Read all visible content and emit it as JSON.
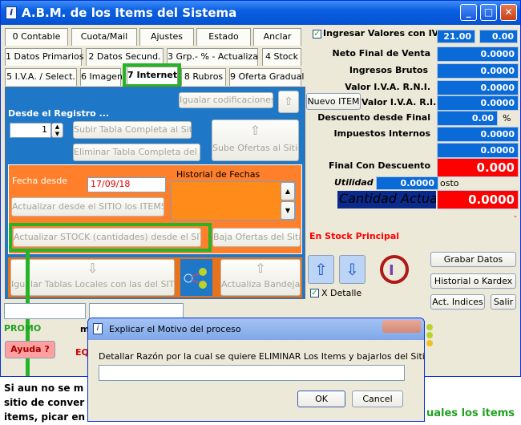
{
  "window": {
    "title": "A.B.M. de los Items del Sistema",
    "min": "_",
    "max": "□",
    "close": "✕",
    "icon": "app-icon"
  },
  "tabs_row1": [
    "0 Contable",
    "Cuota/Mail",
    "Ajustes",
    "Estado",
    "Anclar"
  ],
  "tabs_row2": [
    "1 Datos Primarios",
    "2 Datos Secund.",
    "3 Grp.- % - Actualiza",
    "4 Stock"
  ],
  "tabs_row3": [
    "5 I.V.A. / Select.",
    "6 Imagen",
    "7 Internet",
    "8 Rubros",
    "9 Oferta Gradual"
  ],
  "internet": {
    "igualar_cod": "Igualar codificaciones",
    "desde_registro": "Desde el Registro ...",
    "registro_value": "1",
    "subir_tabla": "Subir Tabla Completa al Sitio",
    "eliminar_tabla": "Eliminar Tabla Completa del Sitio",
    "sube_ofertas": "Sube Ofertas al Sitio",
    "fecha_desde_label": "Fecha desde",
    "fecha_desde_value": "17/09/18",
    "historial_label": "Historial de Fechas",
    "actualizar_items": "Actualizar  desde el SITIO los ITEMS",
    "actualizar_stock": "Actualizar  STOCK (cantidades) desde el SITIO",
    "baja_ofertas": "Baja Ofertas del Sitio",
    "igualar_tablas": "Igualar Tablas Locales con las del SITIO",
    "actualiza_bandeja": "Actualiza Bandeja"
  },
  "right": {
    "ingresar_label": "Ingresar Valores con IVA",
    "iva_rate": "21.00",
    "iva_val": "0.00",
    "rows": [
      {
        "label": "Neto Final de Venta",
        "value": "0.0000"
      },
      {
        "label": "Ingresos Brutos",
        "value": "0.0000"
      },
      {
        "label": "Valor I.V.A. R.N.I.",
        "value": "0.0000"
      },
      {
        "label": "Valor I.V.A. R.I.",
        "value": "0.0000"
      },
      {
        "label": "Descuento desde Final",
        "value": "0.00"
      },
      {
        "label": "Impuestos Internos",
        "value": "0.0000"
      },
      {
        "label": "",
        "value": "0.0000"
      }
    ],
    "nuevo_item": "Nuevo ITEM",
    "percent_sign": "%",
    "final_desc_label": "Final Con Descuento",
    "final_desc_value": "0.000",
    "utilidad_label": "Utilidad",
    "utilidad_value": "0.0000",
    "utilidad_suffix": "osto",
    "cantidad_label": "Cantidad Actual",
    "cantidad_value": "0.0000",
    "dash": "-",
    "stock_principal": "En Stock Principal",
    "x_detalle": "X Detalle",
    "grabar": "Grabar Datos",
    "historial_kardex": "Historial o Kardex",
    "act_indices": "Act. Indices",
    "salir": "Salir"
  },
  "bottom": {
    "promo": "PROMO",
    "ayuda": "Ayuda ?",
    "eq": "EQ",
    "m_frag": "m",
    "notes": [
      "Si aun no se m",
      "sitio de conver",
      "items, picar en"
    ],
    "right_note": "uales los items"
  },
  "dialog": {
    "title": "Explicar el Motivo del proceso",
    "text": "Detallar Razón por la cual se quiere ELIMINAR Los Items y bajarlos del Sitio",
    "input": "",
    "ok": "OK",
    "cancel": "Cancel"
  },
  "colors": {
    "accent": "#0a6ad8",
    "panel": "#1f77c8",
    "orange": "#ff7f2a",
    "red": "#ff0000",
    "green_marker": "#27b327",
    "navy": "#0a2a8c"
  }
}
